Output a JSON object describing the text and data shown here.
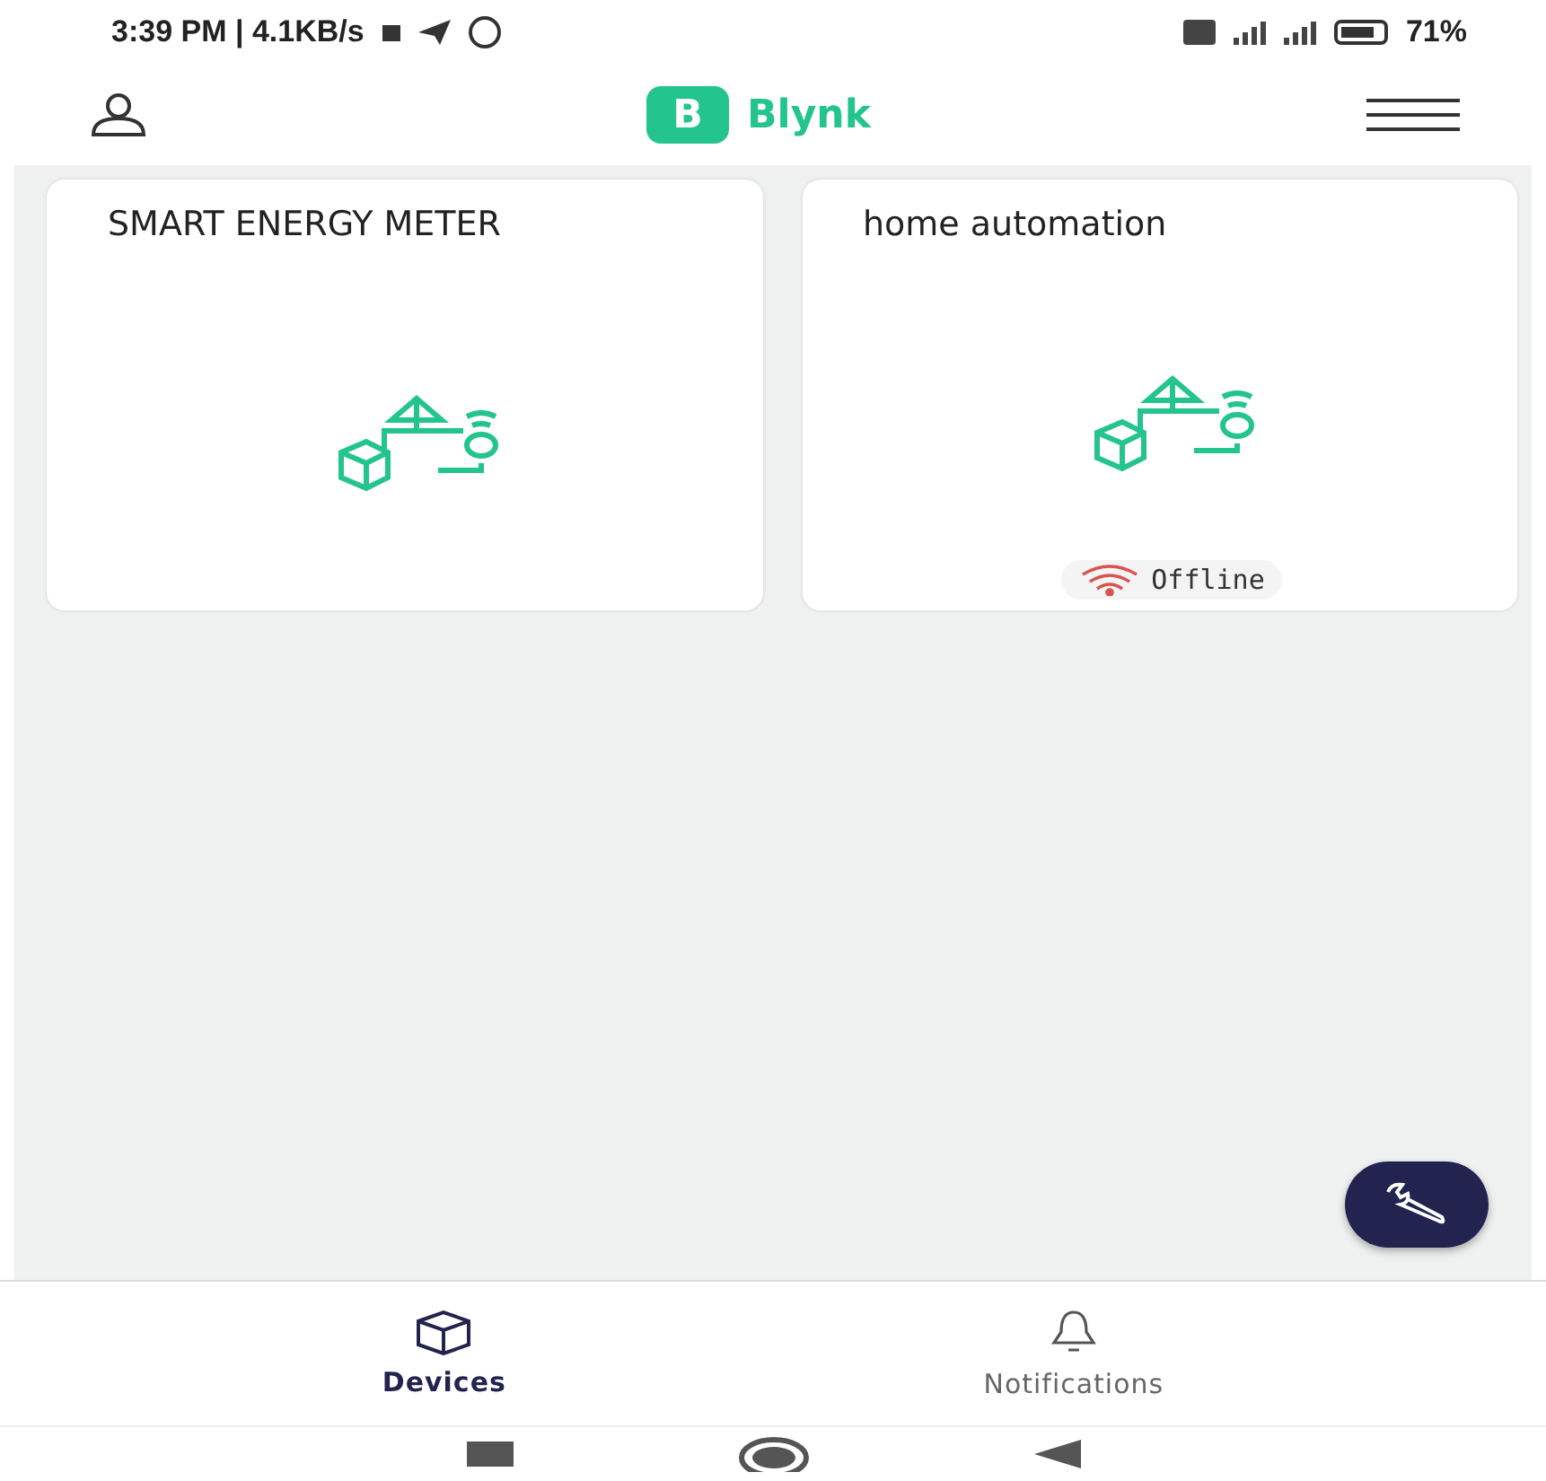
{
  "status_bar": {
    "time": "3:39 PM | 4.1KB/s",
    "battery": "71%"
  },
  "header": {
    "logo_letter": "B",
    "app_name": "Blynk"
  },
  "devices": [
    {
      "name": "SMART ENERGY METER"
    },
    {
      "name": "home automation",
      "status": {
        "kind": "offline",
        "label": "Offline"
      }
    }
  ],
  "tabs": [
    {
      "label": "Devices",
      "kind": "box",
      "selected": true
    },
    {
      "label": "Notifications",
      "kind": "bell",
      "selected": false
    }
  ]
}
